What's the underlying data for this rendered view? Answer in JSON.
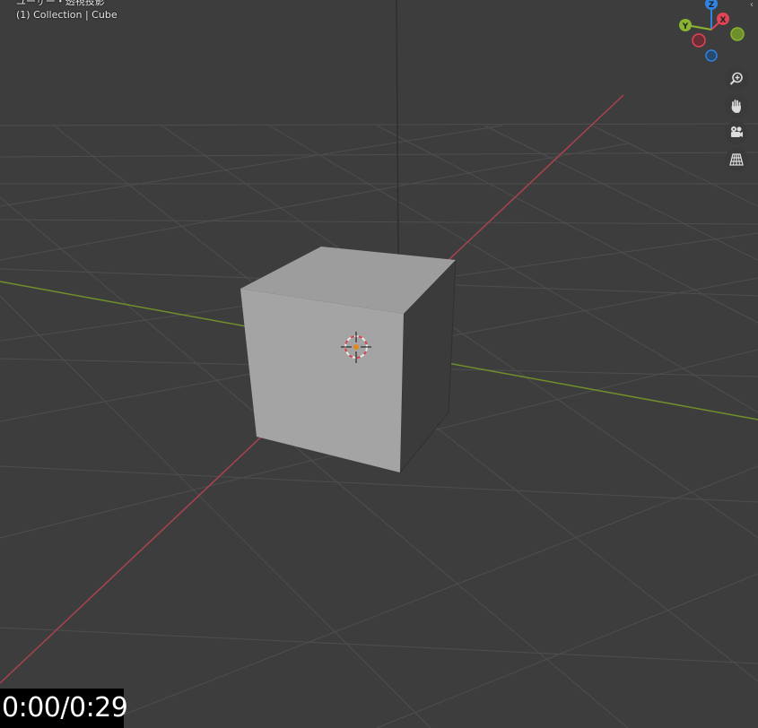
{
  "viewport": {
    "view_mode_text": "ユーザー・透視投影",
    "collection_info": "(1) Collection | Cube"
  },
  "gizmo": {
    "axis_x": "X",
    "axis_y": "Y",
    "axis_z": "Z",
    "colors": {
      "x": "#e04556",
      "y": "#8ab530",
      "z": "#2f84e3"
    }
  },
  "navigation": {
    "icons": [
      "zoom-icon",
      "pan-hand-icon",
      "camera-icon",
      "grid-perspective-icon"
    ]
  },
  "video": {
    "time": "0:00/0:29"
  }
}
